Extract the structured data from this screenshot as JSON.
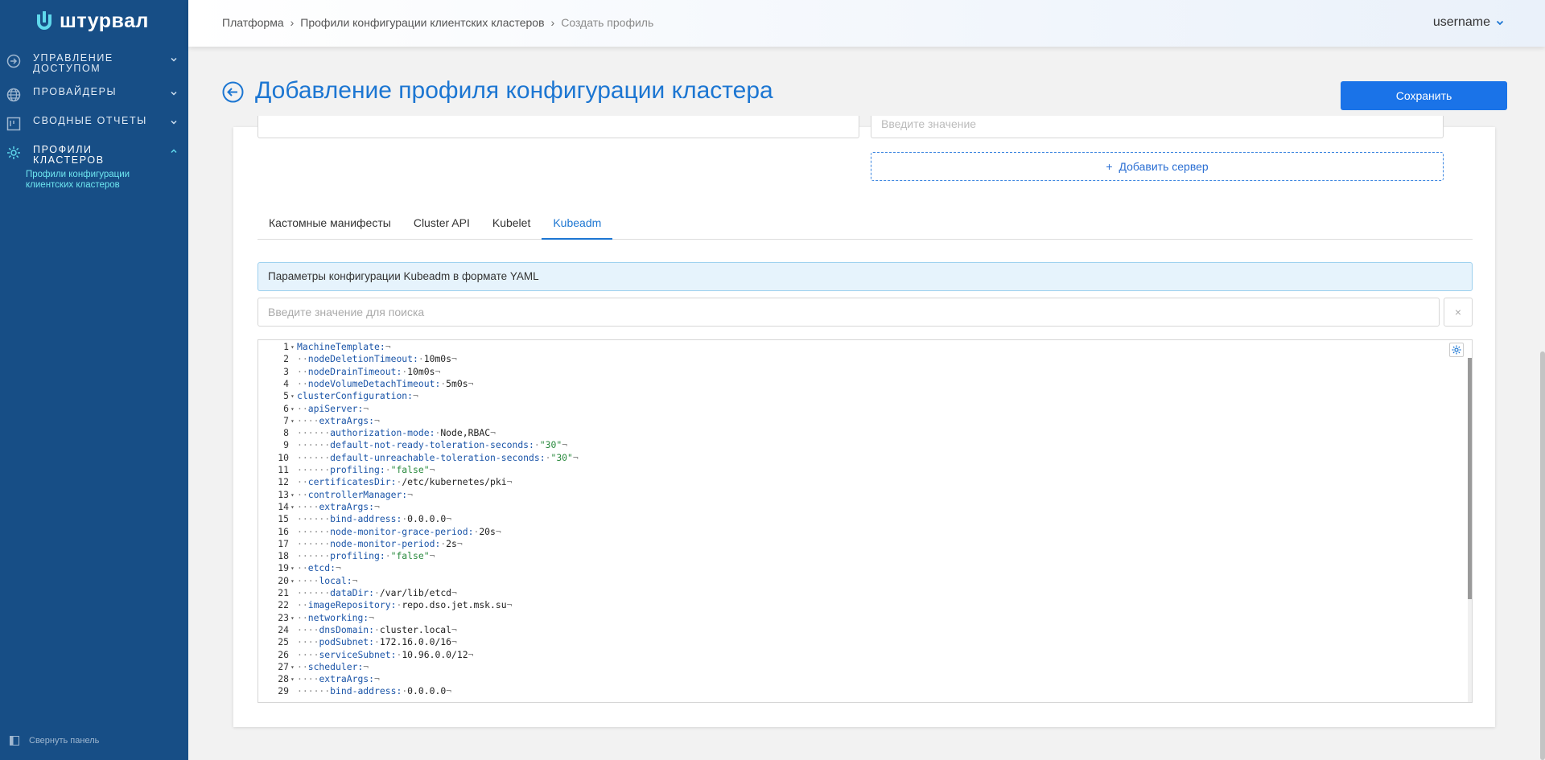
{
  "brand": {
    "name": "штурвал"
  },
  "sidebar": {
    "items": [
      {
        "label": "Управление доступом",
        "icon": "login-icon"
      },
      {
        "label": "Провайдеры",
        "icon": "globe-icon"
      },
      {
        "label": "Сводные отчеты",
        "icon": "board-icon"
      },
      {
        "label": "Профили кластеров",
        "icon": "gear-icon"
      }
    ],
    "sub_items": [
      {
        "label": "Профили конфигурации клиентских кластеров"
      }
    ],
    "collapse_label": "Свернуть панель"
  },
  "breadcrumb": [
    "Платформа",
    "Профили конфигурации клиентских кластеров",
    "Создать профиль"
  ],
  "user": {
    "name": "username"
  },
  "page": {
    "title": "Добавление профиля конфигурации кластера",
    "save_label": "Сохранить"
  },
  "form": {
    "server_placeholder": "Введите значение",
    "add_server_label": "Добавить сервер"
  },
  "tabs": [
    "Кастомные манифесты",
    "Cluster API",
    "Kubelet",
    "Kubeadm"
  ],
  "active_tab": "Kubeadm",
  "info_text": "Параметры конфигурации Kubeadm в формате YAML",
  "search": {
    "placeholder": "Введите значение для поиска",
    "clear_label": "×"
  },
  "editor": {
    "lines": [
      {
        "n": "1",
        "fold": true,
        "indent": 0,
        "key": "MachineTemplate:",
        "value": ""
      },
      {
        "n": "2",
        "fold": false,
        "indent": 1,
        "key": "nodeDeletionTimeout:",
        "value": "10m0s"
      },
      {
        "n": "3",
        "fold": false,
        "indent": 1,
        "key": "nodeDrainTimeout:",
        "value": "10m0s"
      },
      {
        "n": "4",
        "fold": false,
        "indent": 1,
        "key": "nodeVolumeDetachTimeout:",
        "value": "5m0s"
      },
      {
        "n": "5",
        "fold": true,
        "indent": 0,
        "key": "clusterConfiguration:",
        "value": ""
      },
      {
        "n": "6",
        "fold": true,
        "indent": 1,
        "key": "apiServer:",
        "value": ""
      },
      {
        "n": "7",
        "fold": true,
        "indent": 2,
        "key": "extraArgs:",
        "value": ""
      },
      {
        "n": "8",
        "fold": false,
        "indent": 3,
        "key": "authorization-mode:",
        "value": "Node,RBAC"
      },
      {
        "n": "9",
        "fold": false,
        "indent": 3,
        "key": "default-not-ready-toleration-seconds:",
        "value": "\"30\"",
        "string": true
      },
      {
        "n": "10",
        "fold": false,
        "indent": 3,
        "key": "default-unreachable-toleration-seconds:",
        "value": "\"30\"",
        "string": true
      },
      {
        "n": "11",
        "fold": false,
        "indent": 3,
        "key": "profiling:",
        "value": "\"false\"",
        "string": true
      },
      {
        "n": "12",
        "fold": false,
        "indent": 1,
        "key": "certificatesDir:",
        "value": "/etc/kubernetes/pki"
      },
      {
        "n": "13",
        "fold": true,
        "indent": 1,
        "key": "controllerManager:",
        "value": ""
      },
      {
        "n": "14",
        "fold": true,
        "indent": 2,
        "key": "extraArgs:",
        "value": ""
      },
      {
        "n": "15",
        "fold": false,
        "indent": 3,
        "key": "bind-address:",
        "value": "0.0.0.0"
      },
      {
        "n": "16",
        "fold": false,
        "indent": 3,
        "key": "node-monitor-grace-period:",
        "value": "20s"
      },
      {
        "n": "17",
        "fold": false,
        "indent": 3,
        "key": "node-monitor-period:",
        "value": "2s"
      },
      {
        "n": "18",
        "fold": false,
        "indent": 3,
        "key": "profiling:",
        "value": "\"false\"",
        "string": true
      },
      {
        "n": "19",
        "fold": true,
        "indent": 1,
        "key": "etcd:",
        "value": ""
      },
      {
        "n": "20",
        "fold": true,
        "indent": 2,
        "key": "local:",
        "value": ""
      },
      {
        "n": "21",
        "fold": false,
        "indent": 3,
        "key": "dataDir:",
        "value": "/var/lib/etcd"
      },
      {
        "n": "22",
        "fold": false,
        "indent": 1,
        "key": "imageRepository:",
        "value": "repo.dso.jet.msk.su"
      },
      {
        "n": "23",
        "fold": true,
        "indent": 1,
        "key": "networking:",
        "value": ""
      },
      {
        "n": "24",
        "fold": false,
        "indent": 2,
        "key": "dnsDomain:",
        "value": "cluster.local"
      },
      {
        "n": "25",
        "fold": false,
        "indent": 2,
        "key": "podSubnet:",
        "value": "172.16.0.0/16"
      },
      {
        "n": "26",
        "fold": false,
        "indent": 2,
        "key": "serviceSubnet:",
        "value": "10.96.0.0/12"
      },
      {
        "n": "27",
        "fold": true,
        "indent": 1,
        "key": "scheduler:",
        "value": ""
      },
      {
        "n": "28",
        "fold": true,
        "indent": 2,
        "key": "extraArgs:",
        "value": ""
      },
      {
        "n": "29",
        "fold": false,
        "indent": 3,
        "key": "bind-address:",
        "value": "0.0.0.0"
      }
    ]
  },
  "colors": {
    "sidebar": "#174e86",
    "accent": "#1a73e8",
    "sub_item": "#6ee6f0",
    "yaml_key": "#1b55a8",
    "yaml_string": "#2a8a3e"
  }
}
